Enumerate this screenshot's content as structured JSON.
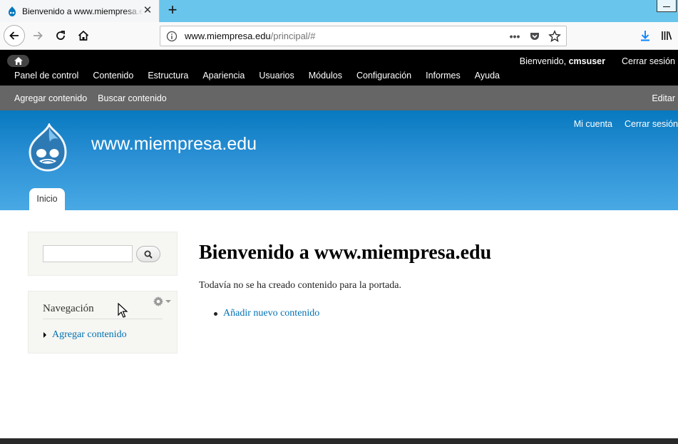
{
  "browser": {
    "tab_title": "Bienvenido a www.miempresa.edu | www.miempresa.edu",
    "url_domain": "www.miempresa.edu",
    "url_path": "/principal/#",
    "page_actions_label": "•••"
  },
  "toolbar": {
    "menu": [
      "Panel de control",
      "Contenido",
      "Estructura",
      "Apariencia",
      "Usuarios",
      "Módulos",
      "Configuración",
      "Informes",
      "Ayuda"
    ],
    "welcome_prefix": "Bienvenido, ",
    "username": "cmsuser",
    "logout": "Cerrar sesión"
  },
  "shortcuts": {
    "items": [
      "Agregar contenido",
      "Buscar contenido"
    ],
    "edit": "Editar"
  },
  "header": {
    "secondary_menu": [
      "Mi cuenta",
      "Cerrar sesión"
    ],
    "site_name": "www.miempresa.edu",
    "main_tab": "Inicio"
  },
  "sidebar": {
    "search_value": "",
    "nav_title": "Navegación",
    "nav_items": [
      "Agregar contenido"
    ]
  },
  "main": {
    "title": "Bienvenido a www.miempresa.edu",
    "message": "Todavía no se ha creado contenido para la portada.",
    "add_link": "Añadir nuevo contenido"
  },
  "colors": {
    "toolbar_bg": "#000000",
    "shortcuts_bg": "#666666",
    "header_top": "#0779bf",
    "header_bottom": "#48a9e4",
    "link": "#0071b3",
    "tab_strip": "#69c5ec"
  }
}
